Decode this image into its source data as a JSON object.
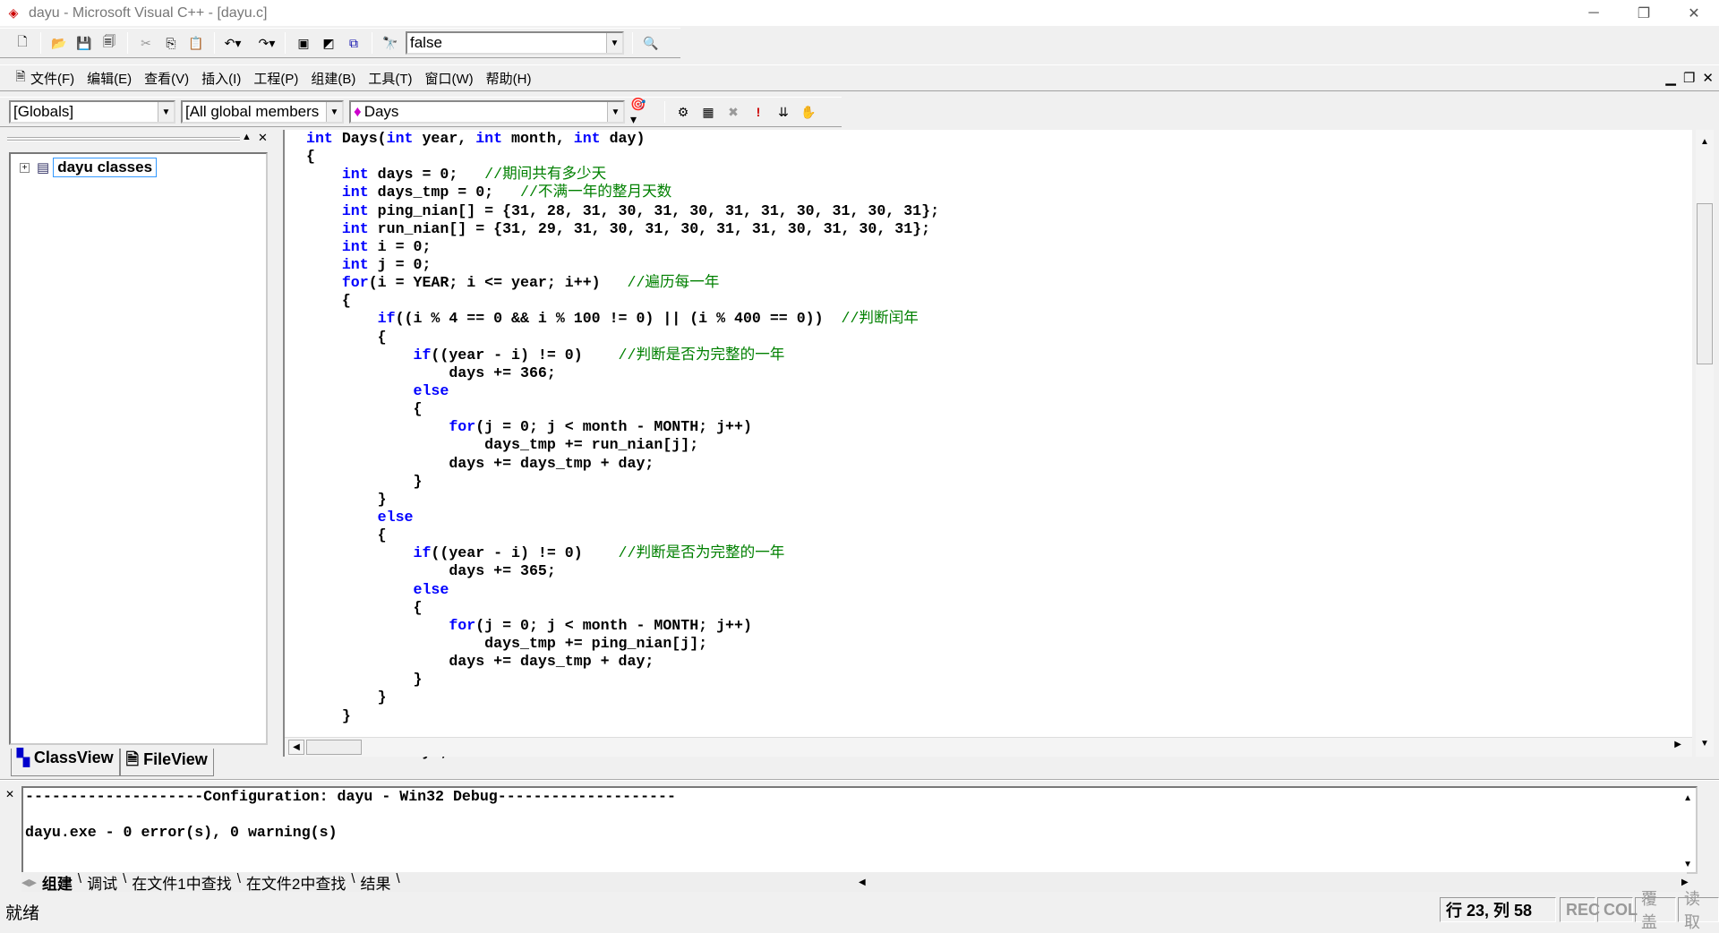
{
  "window": {
    "title": "dayu - Microsoft Visual C++ - [dayu.c]"
  },
  "toolbar": {
    "find_value": "false"
  },
  "menu": [
    "文件(F)",
    "编辑(E)",
    "查看(V)",
    "插入(I)",
    "工程(P)",
    "组建(B)",
    "工具(T)",
    "窗口(W)",
    "帮助(H)"
  ],
  "wizardbar": {
    "scope": "[Globals]",
    "filter": "[All global members",
    "member": "Days"
  },
  "workspace": {
    "tree_root": "dayu classes",
    "tabs": [
      "ClassView",
      "FileView"
    ]
  },
  "code": [
    [
      [
        "k",
        "int"
      ],
      [
        "t",
        " Days("
      ],
      [
        "k",
        "int"
      ],
      [
        "t",
        " year, "
      ],
      [
        "k",
        "int"
      ],
      [
        "t",
        " month, "
      ],
      [
        "k",
        "int"
      ],
      [
        "t",
        " day)"
      ]
    ],
    [
      [
        "t",
        "{"
      ]
    ],
    [
      [
        "t",
        "    "
      ],
      [
        "k",
        "int"
      ],
      [
        "t",
        " days = 0;   "
      ],
      [
        "c",
        "//期间共有多少天"
      ]
    ],
    [
      [
        "t",
        "    "
      ],
      [
        "k",
        "int"
      ],
      [
        "t",
        " days_tmp = 0;   "
      ],
      [
        "c",
        "//不满一年的整月天数"
      ]
    ],
    [
      [
        "t",
        "    "
      ],
      [
        "k",
        "int"
      ],
      [
        "t",
        " ping_nian[] = {31, 28, 31, 30, 31, 30, 31, 31, 30, 31, 30, 31};"
      ]
    ],
    [
      [
        "t",
        "    "
      ],
      [
        "k",
        "int"
      ],
      [
        "t",
        " run_nian[] = {31, 29, 31, 30, 31, 30, 31, 31, 30, 31, 30, 31};"
      ]
    ],
    [
      [
        "t",
        "    "
      ],
      [
        "k",
        "int"
      ],
      [
        "t",
        " i = 0;"
      ]
    ],
    [
      [
        "t",
        "    "
      ],
      [
        "k",
        "int"
      ],
      [
        "t",
        " j = 0;"
      ]
    ],
    [
      [
        "t",
        "    "
      ],
      [
        "k",
        "for"
      ],
      [
        "t",
        "(i = YEAR; i <= year; i++)   "
      ],
      [
        "c",
        "//遍历每一年"
      ]
    ],
    [
      [
        "t",
        "    {"
      ]
    ],
    [
      [
        "t",
        "        "
      ],
      [
        "k",
        "if"
      ],
      [
        "t",
        "((i % 4 == 0 && i % 100 != 0) || (i % 400 == 0))  "
      ],
      [
        "c",
        "//判断闰年"
      ]
    ],
    [
      [
        "t",
        "        {"
      ]
    ],
    [
      [
        "t",
        "            "
      ],
      [
        "k",
        "if"
      ],
      [
        "t",
        "((year - i) != 0)    "
      ],
      [
        "c",
        "//判断是否为完整的一年"
      ]
    ],
    [
      [
        "t",
        "                days += 366;"
      ]
    ],
    [
      [
        "t",
        "            "
      ],
      [
        "k",
        "else"
      ]
    ],
    [
      [
        "t",
        "            {"
      ]
    ],
    [
      [
        "t",
        "                "
      ],
      [
        "k",
        "for"
      ],
      [
        "t",
        "(j = 0; j < month - MONTH; j++)"
      ]
    ],
    [
      [
        "t",
        "                    days_tmp += run_nian[j];"
      ]
    ],
    [
      [
        "t",
        "                days += days_tmp + day;"
      ]
    ],
    [
      [
        "t",
        "            }"
      ]
    ],
    [
      [
        "t",
        "        }"
      ]
    ],
    [
      [
        "t",
        "        "
      ],
      [
        "k",
        "else"
      ]
    ],
    [
      [
        "t",
        "        {"
      ]
    ],
    [
      [
        "t",
        "            "
      ],
      [
        "k",
        "if"
      ],
      [
        "t",
        "((year - i) != 0)    "
      ],
      [
        "c",
        "//判断是否为完整的一年"
      ]
    ],
    [
      [
        "t",
        "                days += 365;"
      ]
    ],
    [
      [
        "t",
        "            "
      ],
      [
        "k",
        "else"
      ]
    ],
    [
      [
        "t",
        "            {"
      ]
    ],
    [
      [
        "t",
        "                "
      ],
      [
        "k",
        "for"
      ],
      [
        "t",
        "(j = 0; j < month - MONTH; j++)"
      ]
    ],
    [
      [
        "t",
        "                    days_tmp += ping_nian[j];"
      ]
    ],
    [
      [
        "t",
        "                days += days_tmp + day;"
      ]
    ],
    [
      [
        "t",
        "            }"
      ]
    ],
    [
      [
        "t",
        "        }"
      ]
    ],
    [
      [
        "t",
        "    }"
      ]
    ],
    [
      [
        "t",
        ""
      ]
    ],
    [
      [
        "t",
        "    "
      ],
      [
        "k",
        "return"
      ],
      [
        "t",
        " days;"
      ]
    ]
  ],
  "output": {
    "lines": [
      "--------------------Configuration: dayu - Win32 Debug--------------------",
      "",
      "dayu.exe - 0 error(s), 0 warning(s)"
    ],
    "tabs": [
      "组建",
      "调试",
      "在文件1中查找",
      "在文件2中查找",
      "结果"
    ]
  },
  "status": {
    "text": "就绪",
    "position": "行 23, 列 58",
    "rec": "REC",
    "col": "COL",
    "ovr": "覆盖",
    "read": "读取"
  }
}
